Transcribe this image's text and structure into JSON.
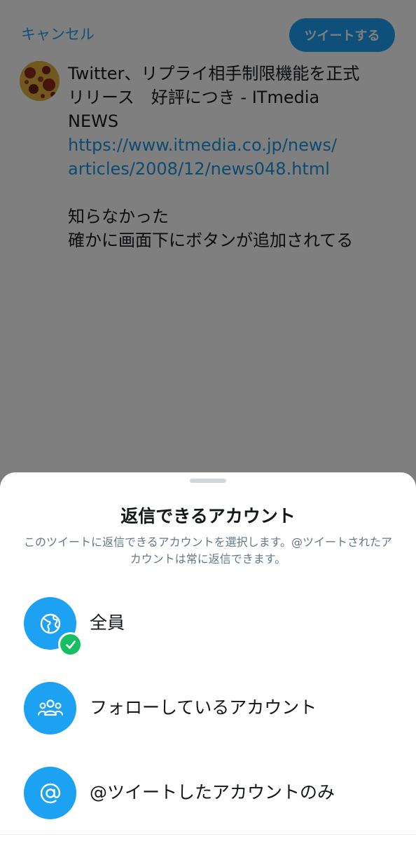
{
  "colors": {
    "accent": "#1da1f2",
    "link": "#1b95e0",
    "check": "#17bf63",
    "text_primary": "#14171a",
    "text_secondary": "#657786"
  },
  "composer": {
    "cancel_label": "キャンセル",
    "tweet_button_label": "ツイートする",
    "tweet_lines": [
      "Twitter、リプライ相手制限機能を正式",
      "リリース　好評につき - ITmedia",
      "NEWS"
    ],
    "link_lines": [
      "https://www.itmedia.co.jp/news/",
      "articles/2008/12/news048.html"
    ],
    "body_lines": [
      "知らなかった",
      "確かに画面下にボタンが追加されてる"
    ]
  },
  "reply_sheet": {
    "title": "返信できるアカウント",
    "description": "このツイートに返信できるアカウントを選択します。@ツイートされたアカウントは常に返信できます。",
    "options": [
      {
        "label": "全員",
        "icon": "globe-icon",
        "selected": true
      },
      {
        "label": "フォローしているアカウント",
        "icon": "people-icon",
        "selected": false
      },
      {
        "label": "@ツイートしたアカウントのみ",
        "icon": "at-sign-icon",
        "selected": false
      }
    ]
  }
}
